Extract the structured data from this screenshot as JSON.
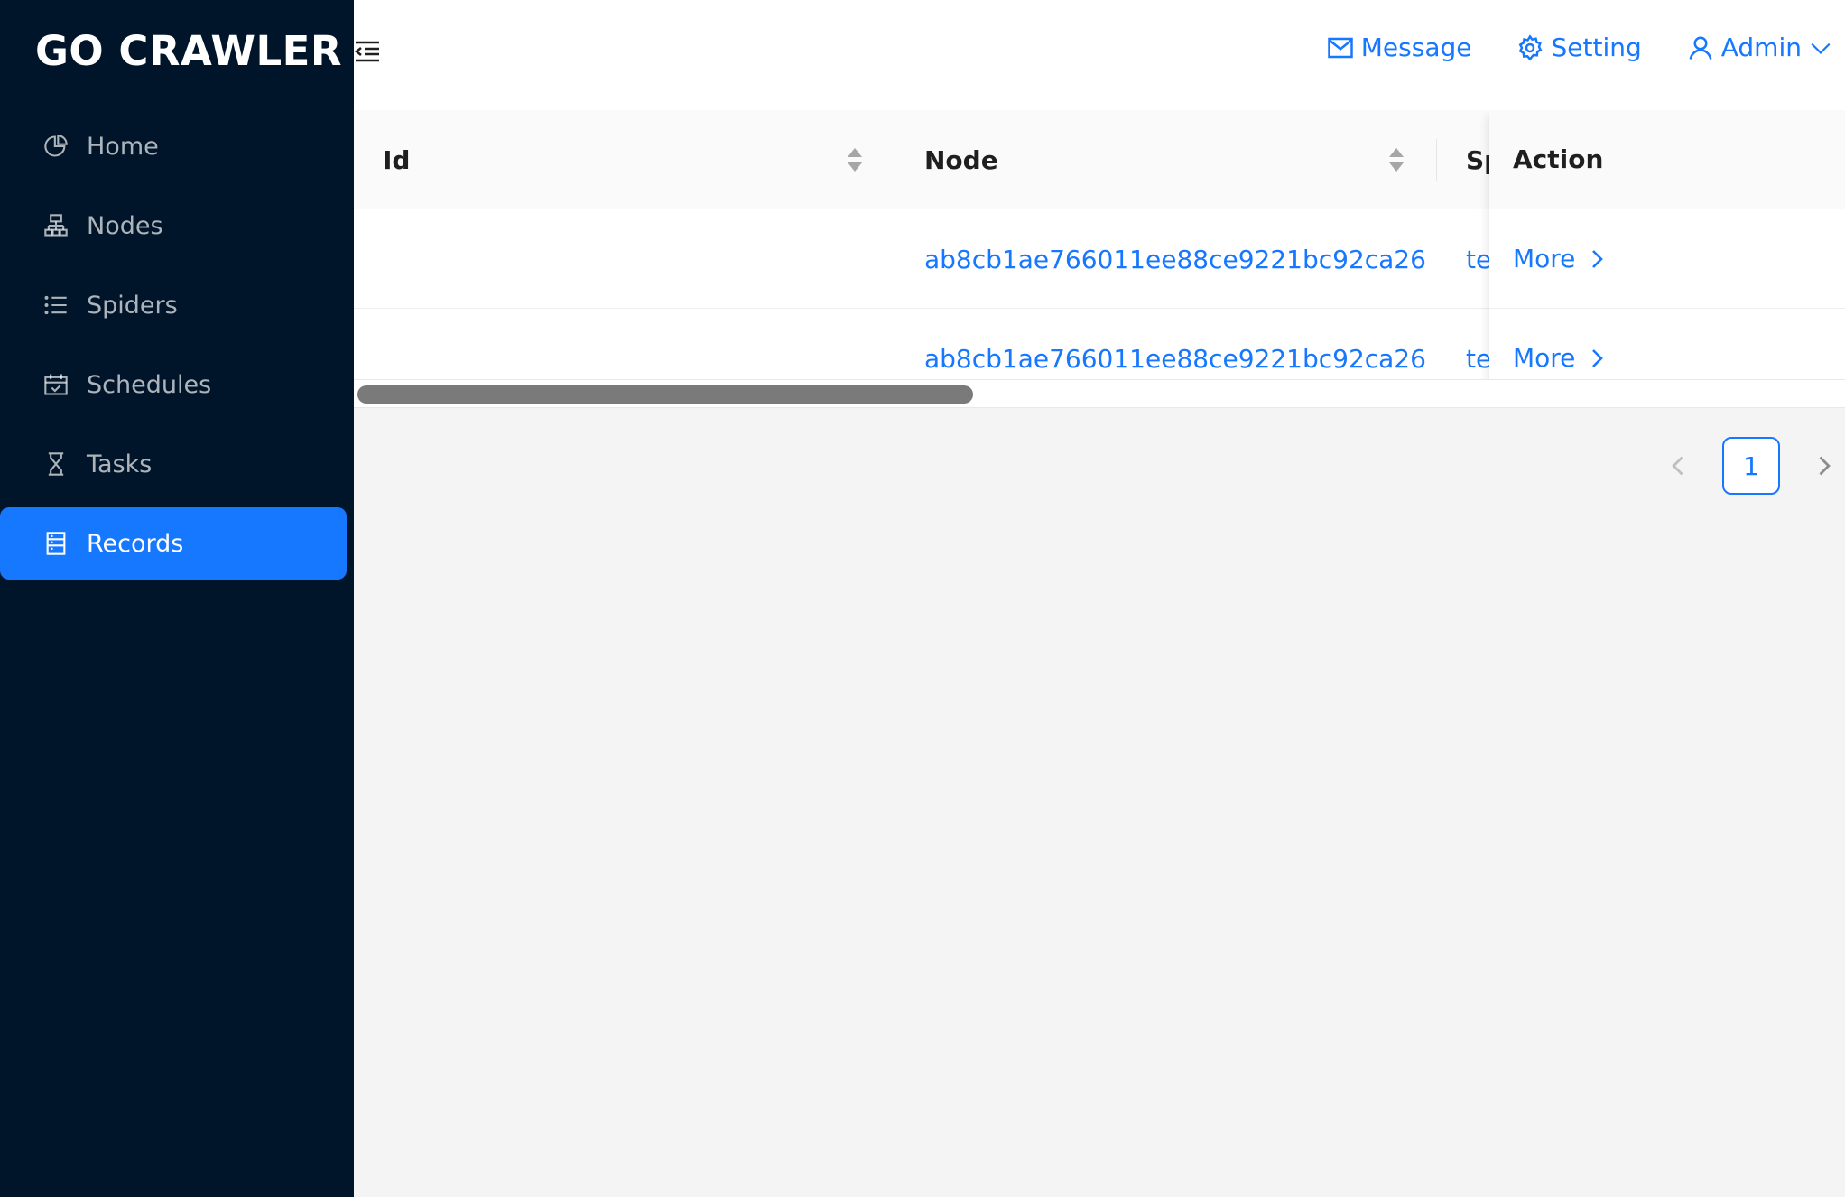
{
  "app": {
    "logo": "GO CRAWLER"
  },
  "sidebar": {
    "items": [
      {
        "label": "Home",
        "icon": "pie-chart-icon",
        "active": false
      },
      {
        "label": "Nodes",
        "icon": "cluster-icon",
        "active": false
      },
      {
        "label": "Spiders",
        "icon": "unordered-list-icon",
        "active": false
      },
      {
        "label": "Schedules",
        "icon": "schedule-icon",
        "active": false
      },
      {
        "label": "Tasks",
        "icon": "hourglass-icon",
        "active": false
      },
      {
        "label": "Records",
        "icon": "database-icon",
        "active": true
      }
    ]
  },
  "header": {
    "message_label": "Message",
    "setting_label": "Setting",
    "user_label": "Admin"
  },
  "table": {
    "columns": [
      "Id",
      "Node",
      "Sp",
      "Action"
    ],
    "rows": [
      {
        "id": "",
        "node": "ab8cb1ae766011ee88ce9221bc92ca26",
        "spider": "te",
        "action": "More"
      },
      {
        "id": "",
        "node": "ab8cb1ae766011ee88ce9221bc92ca26",
        "spider": "te",
        "action": "More"
      }
    ]
  },
  "pagination": {
    "current_page": "1"
  },
  "colors": {
    "sidebar_bg": "#001529",
    "accent": "#1677ff",
    "content_bg": "#f4f4f4"
  }
}
